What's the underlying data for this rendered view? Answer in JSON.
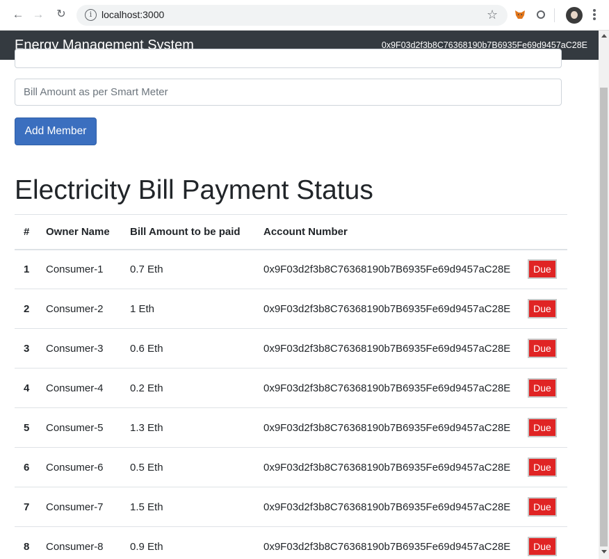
{
  "browser": {
    "url": "localhost:3000"
  },
  "navbar": {
    "brand": "Energy Management System",
    "account": "0x9F03d2f3b8C76368190b7B6935Fe69d9457aC28E"
  },
  "form": {
    "bill_placeholder": "Bill Amount as per Smart Meter",
    "add_button_label": "Add Member"
  },
  "section": {
    "title": "Electricity Bill Payment Status"
  },
  "table": {
    "headers": [
      "#",
      "Owner Name",
      "Bill Amount to be paid",
      "Account Number"
    ],
    "rows": [
      {
        "num": "1",
        "owner": "Consumer-1",
        "amount": "0.7 Eth",
        "account": "0x9F03d2f3b8C76368190b7B6935Fe69d9457aC28E",
        "status": "Due"
      },
      {
        "num": "2",
        "owner": "Consumer-2",
        "amount": "1 Eth",
        "account": "0x9F03d2f3b8C76368190b7B6935Fe69d9457aC28E",
        "status": "Due"
      },
      {
        "num": "3",
        "owner": "Consumer-3",
        "amount": "0.6 Eth",
        "account": "0x9F03d2f3b8C76368190b7B6935Fe69d9457aC28E",
        "status": "Due"
      },
      {
        "num": "4",
        "owner": "Consumer-4",
        "amount": "0.2 Eth",
        "account": "0x9F03d2f3b8C76368190b7B6935Fe69d9457aC28E",
        "status": "Due"
      },
      {
        "num": "5",
        "owner": "Consumer-5",
        "amount": "1.3 Eth",
        "account": "0x9F03d2f3b8C76368190b7B6935Fe69d9457aC28E",
        "status": "Due"
      },
      {
        "num": "6",
        "owner": "Consumer-6",
        "amount": "0.5 Eth",
        "account": "0x9F03d2f3b8C76368190b7B6935Fe69d9457aC28E",
        "status": "Due"
      },
      {
        "num": "7",
        "owner": "Consumer-7",
        "amount": "1.5 Eth",
        "account": "0x9F03d2f3b8C76368190b7B6935Fe69d9457aC28E",
        "status": "Due"
      },
      {
        "num": "8",
        "owner": "Consumer-8",
        "amount": "0.9 Eth",
        "account": "0x9F03d2f3b8C76368190b7B6935Fe69d9457aC28E",
        "status": "Due"
      }
    ]
  },
  "colors": {
    "navbar_bg": "#343a40",
    "primary_button": "#3b6fbf",
    "due_badge": "#e02424"
  },
  "icons": [
    "back-arrow-icon",
    "forward-arrow-icon",
    "reload-icon",
    "site-info-icon",
    "bookmark-star-icon",
    "metamask-fox-icon",
    "extension-icon",
    "profile-avatar",
    "chrome-menu-icon"
  ]
}
